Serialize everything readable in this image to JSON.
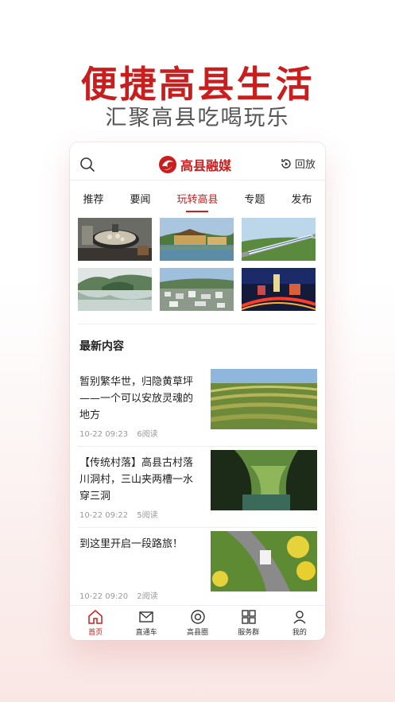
{
  "promo": {
    "headline": "便捷高县生活",
    "subline": "汇聚高县吃喝玩乐"
  },
  "topbar": {
    "search_icon": "search-icon",
    "logo_text": "高县融媒",
    "replay_label": "回放"
  },
  "tabs": [
    {
      "label": "推荐"
    },
    {
      "label": "要闻"
    },
    {
      "label": "玩转高县"
    },
    {
      "label": "专题"
    },
    {
      "label": "发布"
    }
  ],
  "active_tab": "玩转高县",
  "section_title": "最新内容",
  "articles": [
    {
      "title": "暂别繁华世，归隐黄草坪——一个可以安放灵魂的地方",
      "time": "10-22 09:23",
      "reads": "6阅读"
    },
    {
      "title": "【传统村落】高县古村落川洞村，三山夹两槽一水穿三洞",
      "time": "10-22 09:22",
      "reads": "5阅读"
    },
    {
      "title": "到这里开启一段路旅！",
      "time": "10-22 09:20",
      "reads": "2阅读"
    }
  ],
  "bottom_nav": [
    {
      "label": "首页",
      "icon": "home-icon"
    },
    {
      "label": "直通车",
      "icon": "envelope-icon"
    },
    {
      "label": "高县圈",
      "icon": "circle-icon"
    },
    {
      "label": "服务群",
      "icon": "grid-icon"
    },
    {
      "label": "我的",
      "icon": "user-icon"
    }
  ],
  "colors": {
    "brand": "#c81e1e",
    "text": "#222222",
    "muted": "#999999"
  }
}
